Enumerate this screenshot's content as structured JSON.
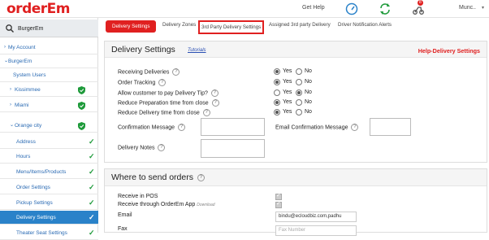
{
  "header": {
    "logo": "orderEm",
    "get_help": "Get Help",
    "notification_count": "8",
    "user_name": "Munc.."
  },
  "sidebar": {
    "search_value": "BurgerEm",
    "items": [
      {
        "label": "My Account"
      },
      {
        "label": "BurgerEm"
      },
      {
        "label": "System Users"
      },
      {
        "label": "Kissimmee"
      },
      {
        "label": "Miami"
      },
      {
        "label": "Orange city"
      },
      {
        "label": "Address"
      },
      {
        "label": "Hours"
      },
      {
        "label": "Menu/Items/Products"
      },
      {
        "label": "Order Settings"
      },
      {
        "label": "Pickup Settings"
      },
      {
        "label": "Delivery Settings"
      },
      {
        "label": "Theater Seat Settings"
      }
    ]
  },
  "tabs": [
    {
      "label": "Delivery Settings"
    },
    {
      "label": "Delivery Zones"
    },
    {
      "label": "3rd Party Delivery Settings"
    },
    {
      "label": "Assigned 3rd party Delivery"
    },
    {
      "label": "Driver Notification Alerts"
    }
  ],
  "delivery_panel": {
    "title": "Delivery Settings",
    "tutorials": "Tutorials",
    "help": "Help-Delivery Settings",
    "yes": "Yes",
    "no": "No",
    "rows": [
      {
        "label": "Receiving Deliveries",
        "value": "Yes"
      },
      {
        "label": "Order Tracking",
        "value": "Yes"
      },
      {
        "label": "Allow customer to pay Delivery Tip?",
        "value": "No"
      },
      {
        "label": "Reduce Preparation time from close",
        "value": "Yes"
      },
      {
        "label": "Reduce Delivery time from close",
        "value": "Yes"
      }
    ],
    "confirmation_message": "Confirmation Message",
    "email_confirmation_message": "Email Confirmation Message",
    "delivery_notes": "Delivery Notes"
  },
  "orders_panel": {
    "title": "Where to send orders",
    "receive_pos": "Receive in POS",
    "receive_app": "Receive through OrderEm App",
    "download": "Download",
    "email_label": "Email",
    "email_value": "bindu@ecloudbiz.com,padhu",
    "fax_label": "Fax",
    "fax_placeholder": "Fax Number"
  },
  "colors": {
    "brand_red": "#e02020",
    "active_blue": "#2a82c9",
    "link_blue": "#2a6ab3",
    "check_green": "#1e9a3a"
  }
}
